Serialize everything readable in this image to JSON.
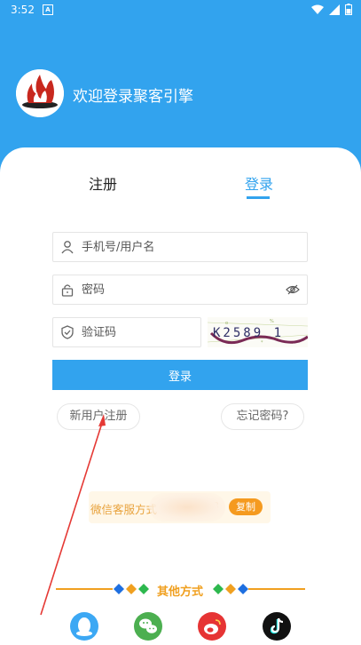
{
  "status_bar": {
    "time": "3:52",
    "notif": "A"
  },
  "header": {
    "welcome_text": "欢迎登录聚客引擎"
  },
  "tabs": {
    "register_label": "注册",
    "login_label": "登录"
  },
  "form": {
    "username_placeholder": "手机号/用户名",
    "password_placeholder": "密码",
    "captcha_placeholder": "验证码",
    "captcha_text": "K2589 1",
    "login_button": "登录"
  },
  "links": {
    "new_user_register": "新用户注册",
    "forgot_password": "忘记密码?"
  },
  "wechat_service": {
    "label": "微信客服方式",
    "partial_number": "913",
    "copy_button": "复制"
  },
  "other_methods": {
    "label": "其他方式",
    "icons": [
      "qq-icon",
      "wechat-icon",
      "weibo-icon",
      "douyin-icon"
    ]
  },
  "colors": {
    "primary": "#32A3EE",
    "accent": "#F0A020",
    "copy": "#F59A1F"
  }
}
